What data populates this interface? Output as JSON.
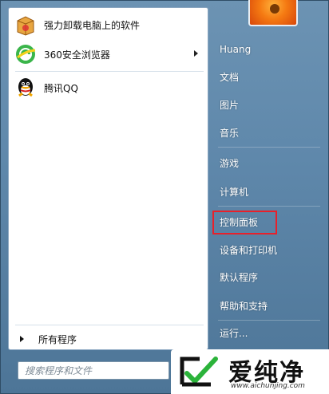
{
  "programs": [
    {
      "label": "强力卸载电脑上的软件",
      "icon": "uninstaller-box-icon"
    },
    {
      "label": "360安全浏览器",
      "icon": "360-browser-icon",
      "has_submenu": true
    },
    {
      "label": "腾讯QQ",
      "icon": "qq-penguin-icon"
    }
  ],
  "all_programs_label": "所有程序",
  "search": {
    "placeholder": "搜索程序和文件"
  },
  "right_items": [
    {
      "label": "Huang"
    },
    {
      "label": "文档"
    },
    {
      "label": "图片"
    },
    {
      "label": "音乐"
    },
    {
      "label": "游戏"
    },
    {
      "label": "计算机"
    },
    {
      "label": "控制面板",
      "highlighted": true
    },
    {
      "label": "设备和打印机"
    },
    {
      "label": "默认程序"
    },
    {
      "label": "帮助和支持"
    },
    {
      "label": "运行..."
    }
  ],
  "watermark": {
    "title": "爱纯净",
    "url": "www.aichunjing.com"
  },
  "colors": {
    "highlight": "#e8202a",
    "menu_blue": "#5f88ab"
  }
}
